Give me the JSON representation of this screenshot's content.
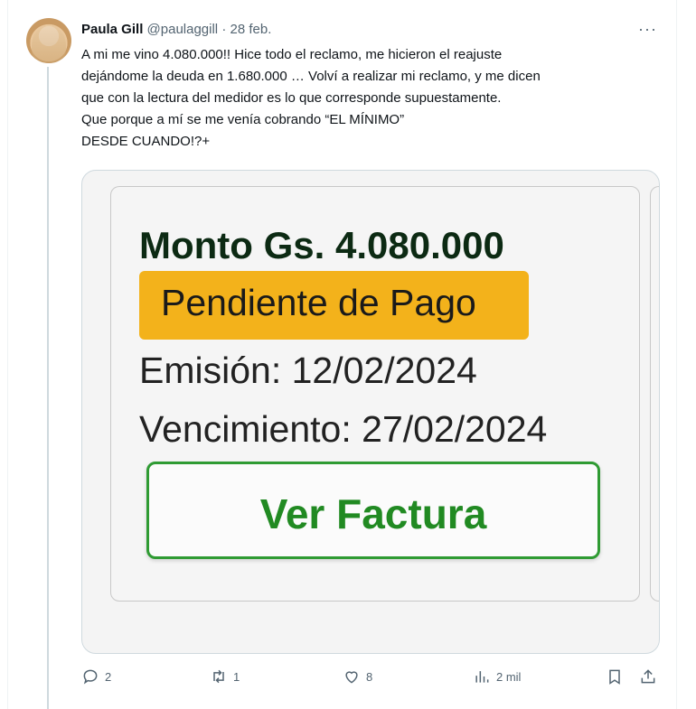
{
  "tweet": {
    "author_name": "Paula Gill",
    "handle": "@paulaggill",
    "separator": "·",
    "date": "28 feb.",
    "more_icon": "···",
    "text_lines": [
      "A mi me vino 4.080.000!! Hice todo el reclamo, me hicieron el reajuste",
      "dejándome la deuda en 1.680.000 … Volví a realizar mi reclamo, y me dicen",
      "que con la lectura del medidor es lo que corresponde supuestamente.",
      "Que porque a mí se me venía cobrando “EL MÍNIMO”",
      "DESDE CUANDO!?+"
    ]
  },
  "media": {
    "amount": "Monto Gs. 4.080.000",
    "status": "Pendiente de Pago",
    "emision": "Emisión: 12/02/2024",
    "vencimiento": "Vencimiento: 27/02/2024",
    "button_label": "Ver Factura",
    "colors": {
      "status_bg": "#f3b21b",
      "button_border": "#2f9b33",
      "button_text": "#218a22"
    }
  },
  "actions": {
    "replies": "2",
    "retweets": "1",
    "likes": "8",
    "views": "2 mil",
    "icons": [
      "reply-icon",
      "retweet-icon",
      "like-icon",
      "views-icon",
      "bookmark-icon",
      "share-icon"
    ]
  }
}
